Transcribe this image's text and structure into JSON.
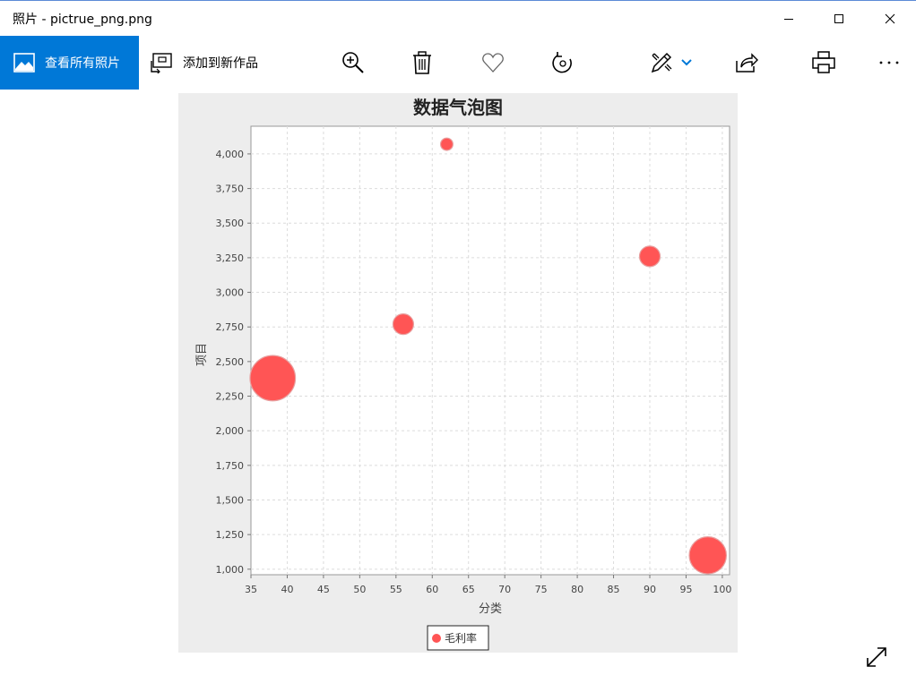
{
  "window": {
    "title": "照片 - pictrue_png.png",
    "minimize_icon": "minimize-icon",
    "maximize_icon": "maximize-icon",
    "close_icon": "close-icon"
  },
  "toolbar": {
    "all_photos_label": "查看所有照片",
    "add_to_creation_label": "添加到新作品",
    "icons": [
      "zoom-in-icon",
      "delete-icon",
      "favorite-icon",
      "rotate-icon",
      "edit-icon",
      "share-icon",
      "print-icon",
      "more-icon"
    ]
  },
  "colors": {
    "accent": "#0078d7",
    "bubble": "#ff5555",
    "chart_bg": "#ededed"
  },
  "chart_data": {
    "type": "scatter",
    "title": "数据气泡图",
    "xlabel": "分类",
    "ylabel": "项目",
    "xlim": [
      35,
      101
    ],
    "ylim": [
      960,
      4200
    ],
    "x_ticks": [
      "35",
      "40",
      "45",
      "50",
      "55",
      "60",
      "65",
      "70",
      "75",
      "80",
      "85",
      "90",
      "95",
      "100"
    ],
    "y_ticks": [
      "1,000",
      "1,250",
      "1,500",
      "1,750",
      "2,000",
      "2,250",
      "2,500",
      "2,750",
      "3,000",
      "3,250",
      "3,500",
      "3,750",
      "4,000"
    ],
    "grid": true,
    "legend_position": "bottom",
    "series": [
      {
        "name": "毛利率",
        "points": [
          {
            "x": 38,
            "y": 2380,
            "size": 5.5
          },
          {
            "x": 56,
            "y": 2770,
            "size": 2.5
          },
          {
            "x": 62,
            "y": 4070,
            "size": 1.5
          },
          {
            "x": 90,
            "y": 3260,
            "size": 2.5
          },
          {
            "x": 98,
            "y": 1100,
            "size": 4.5
          }
        ]
      }
    ]
  }
}
